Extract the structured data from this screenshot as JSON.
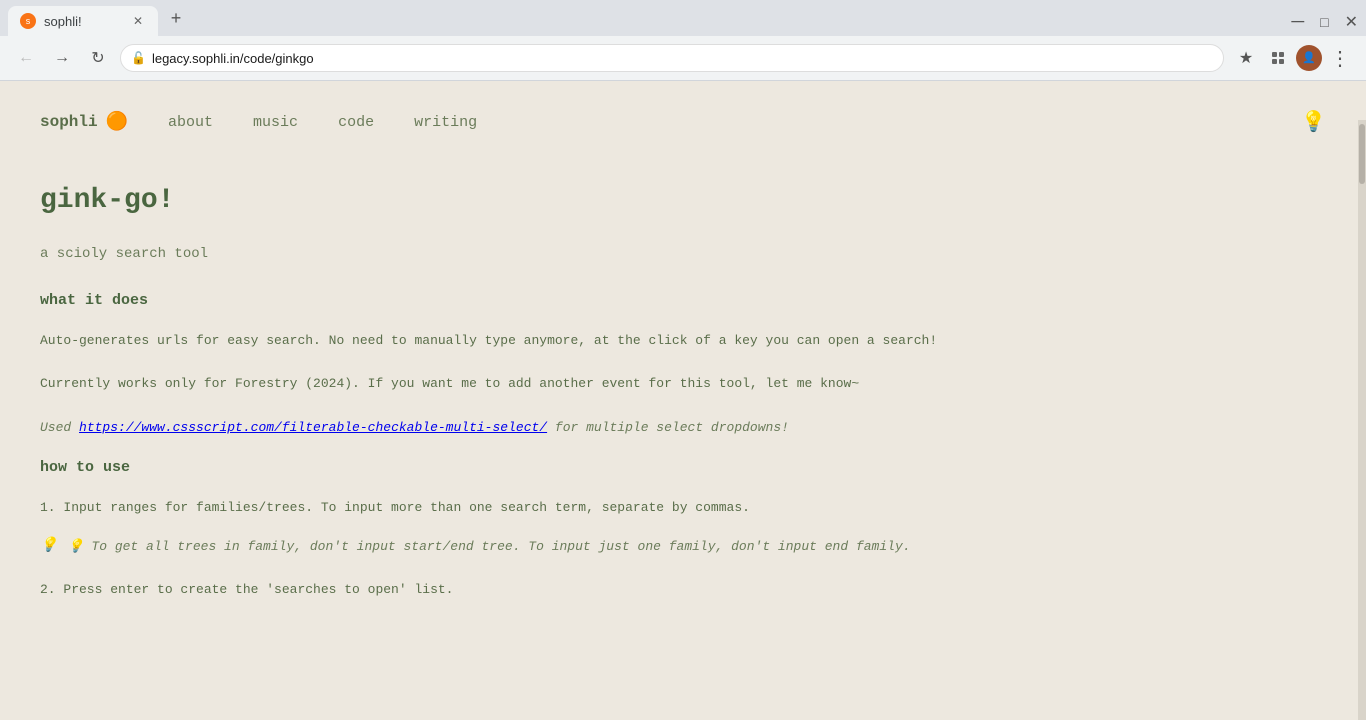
{
  "browser": {
    "tab_title": "sophli!",
    "url": "legacy.sophli.in/code/ginkgo",
    "new_tab_label": "+",
    "profile_initial": ""
  },
  "nav": {
    "logo_text": "sophli",
    "logo_emoji": "🟠",
    "links": [
      {
        "label": "about",
        "href": "#"
      },
      {
        "label": "music",
        "href": "#"
      },
      {
        "label": "code",
        "href": "#"
      },
      {
        "label": "writing",
        "href": "#"
      }
    ],
    "bulb_icon": "💡"
  },
  "page": {
    "title": "gink-go!",
    "subtitle": "a scioly search tool",
    "what_it_does_heading": "what it does",
    "paragraph1": "Auto-generates urls for easy search. No need to manually type anymore, at the click of a key you can open a search!",
    "paragraph2": "Currently works only for Forestry (2024). If you want me to add another event for this tool, let me know~",
    "paragraph3": "Used https://www.cssscript.com/filterable-checkable-multi-select/ for multiple select dropdowns!",
    "how_to_use_heading": "how to use",
    "step1": "1. Input ranges for families/trees. To input more than one search term, separate by commas.",
    "tip1": "💡  To get all trees in family, don't input start/end tree. To input just one family, don't input end family.",
    "step2": "2. Press enter to create the 'searches to open' list."
  }
}
